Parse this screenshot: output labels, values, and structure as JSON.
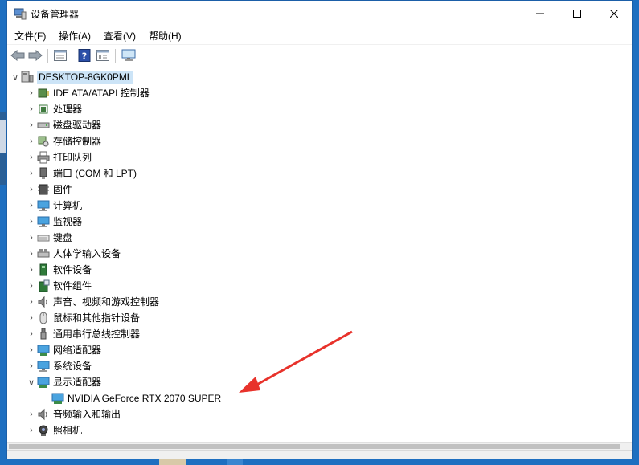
{
  "window": {
    "title": "设备管理器"
  },
  "menu": [
    {
      "label": "文件(F)"
    },
    {
      "label": "操作(A)"
    },
    {
      "label": "查看(V)"
    },
    {
      "label": "帮助(H)"
    }
  ],
  "toolbar": {
    "buttons": [
      "back-icon",
      "forward-icon",
      "properties-icon",
      "help-icon",
      "device-list-icon",
      "monitor-icon"
    ]
  },
  "tree": {
    "root": "DESKTOP-8GK0PML",
    "categories": [
      {
        "label": "IDE ATA/ATAPI 控制器",
        "icon": "ide-controller-icon",
        "expanded": false
      },
      {
        "label": "处理器",
        "icon": "processor-icon",
        "expanded": false
      },
      {
        "label": "磁盘驱动器",
        "icon": "disk-drive-icon",
        "expanded": false
      },
      {
        "label": "存储控制器",
        "icon": "storage-controller-icon",
        "expanded": false
      },
      {
        "label": "打印队列",
        "icon": "printer-icon",
        "expanded": false
      },
      {
        "label": "端口 (COM 和 LPT)",
        "icon": "port-icon",
        "expanded": false
      },
      {
        "label": "固件",
        "icon": "firmware-icon",
        "expanded": false
      },
      {
        "label": "计算机",
        "icon": "computer-icon",
        "expanded": false
      },
      {
        "label": "监视器",
        "icon": "monitor-icon",
        "expanded": false
      },
      {
        "label": "键盘",
        "icon": "keyboard-icon",
        "expanded": false
      },
      {
        "label": "人体学输入设备",
        "icon": "hid-icon",
        "expanded": false
      },
      {
        "label": "软件设备",
        "icon": "software-device-icon",
        "expanded": false
      },
      {
        "label": "软件组件",
        "icon": "software-component-icon",
        "expanded": false
      },
      {
        "label": "声音、视频和游戏控制器",
        "icon": "sound-icon",
        "expanded": false
      },
      {
        "label": "鼠标和其他指针设备",
        "icon": "mouse-icon",
        "expanded": false
      },
      {
        "label": "通用串行总线控制器",
        "icon": "usb-icon",
        "expanded": false
      },
      {
        "label": "网络适配器",
        "icon": "network-adapter-icon",
        "expanded": false
      },
      {
        "label": "系统设备",
        "icon": "system-device-icon",
        "expanded": false
      },
      {
        "label": "显示适配器",
        "icon": "display-adapter-icon",
        "expanded": true,
        "children": [
          {
            "label": "NVIDIA GeForce RTX 2070 SUPER",
            "icon": "gpu-icon"
          }
        ]
      },
      {
        "label": "音频输入和输出",
        "icon": "audio-io-icon",
        "expanded": false
      },
      {
        "label": "照相机",
        "icon": "camera-icon",
        "expanded": false
      }
    ]
  },
  "colors": {
    "accent": "#cce4f7",
    "annotation_arrow": "#e8322b"
  }
}
